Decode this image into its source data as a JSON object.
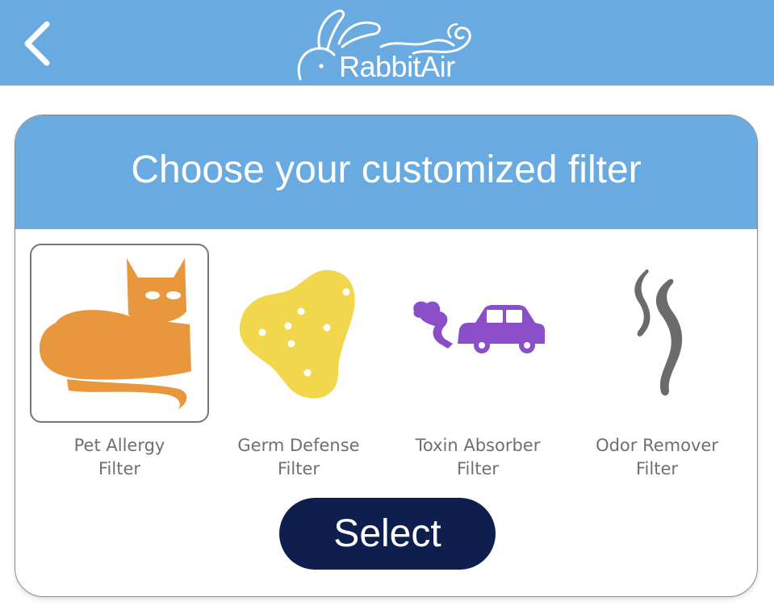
{
  "header": {
    "back_icon": "chevron-left-icon",
    "logo_text": "RabbitAir",
    "background": "#69abe1"
  },
  "card": {
    "title": "Choose your customized filter",
    "header_background": "#69abe1"
  },
  "filters": [
    {
      "line1": "Pet Allergy",
      "line2": "Filter",
      "icon": "cat-icon",
      "color": "#e8973c",
      "selected": true
    },
    {
      "line1": "Germ Defense",
      "line2": "Filter",
      "icon": "germ-icon",
      "color": "#f2d64b",
      "selected": false
    },
    {
      "line1": "Toxin Absorber",
      "line2": "Filter",
      "icon": "car-exhaust-icon",
      "color": "#8a4fc8",
      "selected": false
    },
    {
      "line1": "Odor Remover",
      "line2": "Filter",
      "icon": "odor-smoke-icon",
      "color": "#6b6b6b",
      "selected": false
    }
  ],
  "select_button": {
    "label": "Select",
    "background": "#0d1e4f"
  }
}
